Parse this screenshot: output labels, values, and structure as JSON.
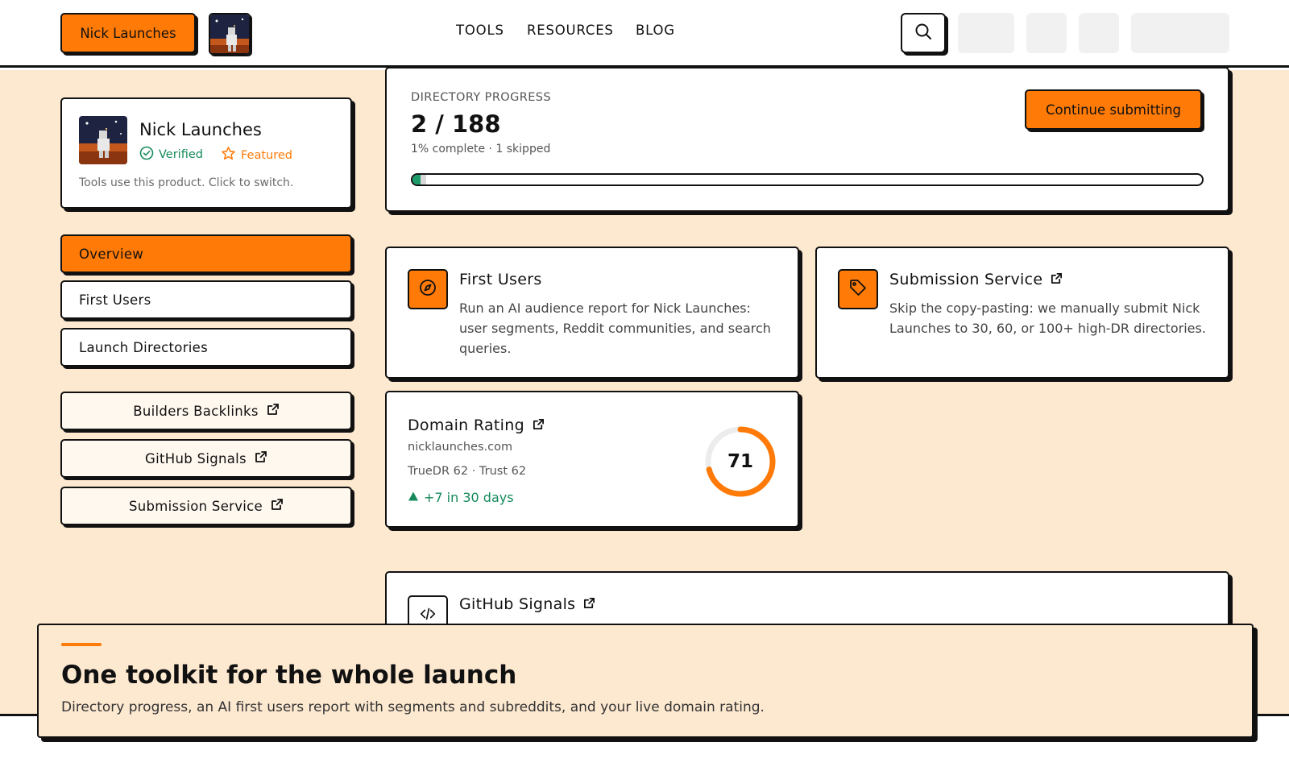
{
  "header": {
    "brand_label": "Nick Launches",
    "nav": [
      "TOOLS",
      "RESOURCES",
      "BLOG"
    ],
    "icons": {
      "search": "search-icon"
    }
  },
  "product": {
    "name": "Nick Launches",
    "verified_label": "Verified",
    "featured_label": "Featured",
    "hint": "Tools use this product. Click to switch."
  },
  "sidebar": {
    "items": [
      {
        "label": "Overview",
        "active": true
      },
      {
        "label": "First Users",
        "active": false
      },
      {
        "label": "Launch Directories",
        "active": false
      }
    ],
    "external": [
      {
        "label": "Builders Backlinks"
      },
      {
        "label": "GitHub Signals"
      },
      {
        "label": "Submission Service"
      }
    ]
  },
  "progress": {
    "label": "DIRECTORY PROGRESS",
    "value": "2 / 188",
    "sub": "1% complete · 1 skipped",
    "completed": 2,
    "skipped": 1,
    "total": 188,
    "button": "Continue submitting"
  },
  "tools": {
    "first_users": {
      "title": "First Users",
      "desc": "Run an AI audience report for Nick Launches: user segments, Reddit communities, and search queries.",
      "icon": "compass-icon"
    },
    "submission_service": {
      "title": "Submission Service",
      "desc": "Skip the copy-pasting: we manually submit Nick Launches to 30, 60, or 100+ high-DR directories.",
      "icon": "tag-icon"
    }
  },
  "domain_rating": {
    "title": "Domain Rating",
    "domain": "nicklaunches.com",
    "meta": "TrueDR 62 · Trust 62",
    "delta": "+7 in 30 days",
    "score": "71",
    "score_fraction": 0.71
  },
  "github": {
    "title": "GitHub Signals",
    "icon": "code-icon"
  },
  "overlay": {
    "title": "One toolkit for the whole launch",
    "subtitle": "Directory progress, an AI first users report with segments and subreddits, and your live domain rating."
  },
  "colors": {
    "accent": "#ff7a06",
    "background": "#fde8d0",
    "success": "#168a5a",
    "ink": "#111111"
  }
}
